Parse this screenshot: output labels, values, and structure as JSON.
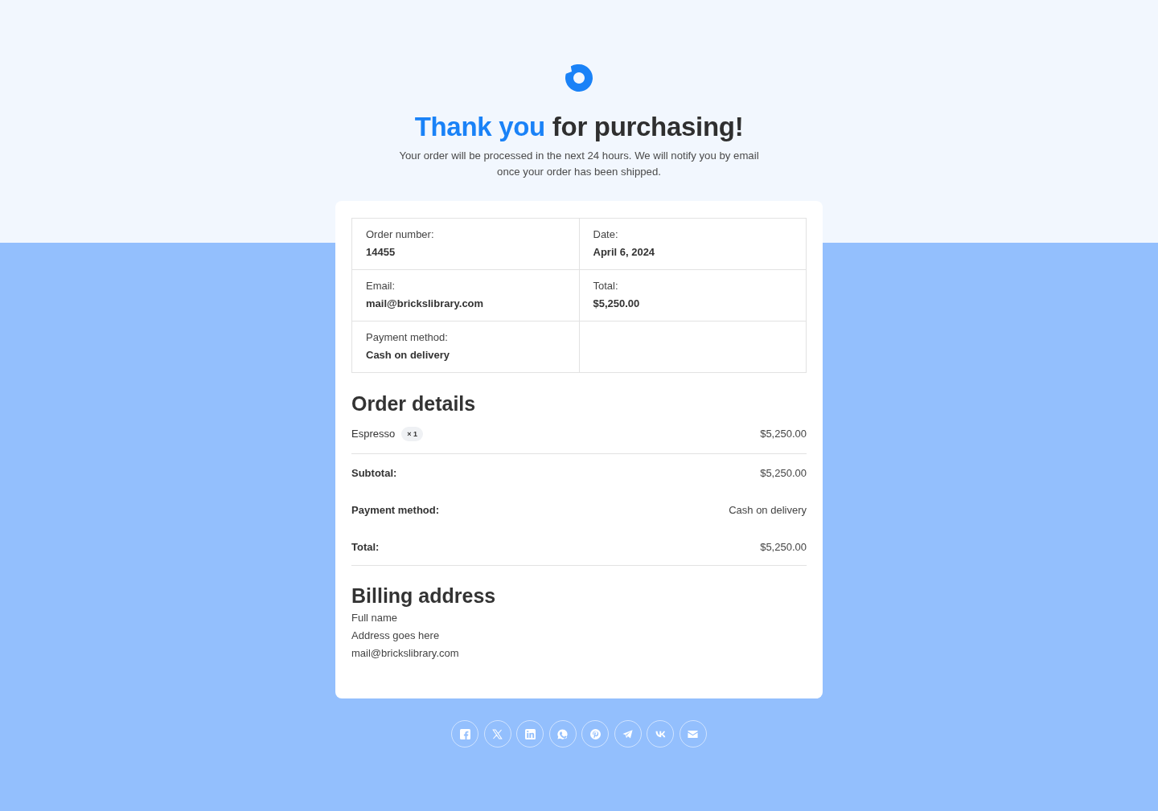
{
  "header": {
    "title_highlight": "Thank you",
    "title_rest": "for purchasing!",
    "message": "Your order will be processed in the next 24 hours. We will notify you by email once your order has been shipped."
  },
  "order_info": [
    {
      "label": "Order number:",
      "value": "14455"
    },
    {
      "label": "Date:",
      "value": "April 6, 2024"
    },
    {
      "label": "Email:",
      "value": "mail@brickslibrary.com"
    },
    {
      "label": "Total:",
      "value": "$5,250.00"
    },
    {
      "label": "Payment method:",
      "value": "Cash on delivery"
    }
  ],
  "order_details": {
    "title": "Order details",
    "items": [
      {
        "name": "Espresso",
        "quantity": "× 1",
        "price": "$5,250.00"
      }
    ],
    "totals": [
      {
        "label": "Subtotal:",
        "value": "$5,250.00"
      },
      {
        "label": "Payment method:",
        "value": "Cash on delivery"
      },
      {
        "label": "Total:",
        "value": "$5,250.00"
      }
    ]
  },
  "billing_address": {
    "title": "Billing address",
    "lines": [
      "Full name",
      "Address goes here",
      "mail@brickslibrary.com"
    ]
  },
  "share_buttons": [
    {
      "kind": "facebook"
    },
    {
      "kind": "x"
    },
    {
      "kind": "linkedin"
    },
    {
      "kind": "whatsapp"
    },
    {
      "kind": "pinterest"
    },
    {
      "kind": "telegram"
    },
    {
      "kind": "vk"
    },
    {
      "kind": "email"
    }
  ]
}
